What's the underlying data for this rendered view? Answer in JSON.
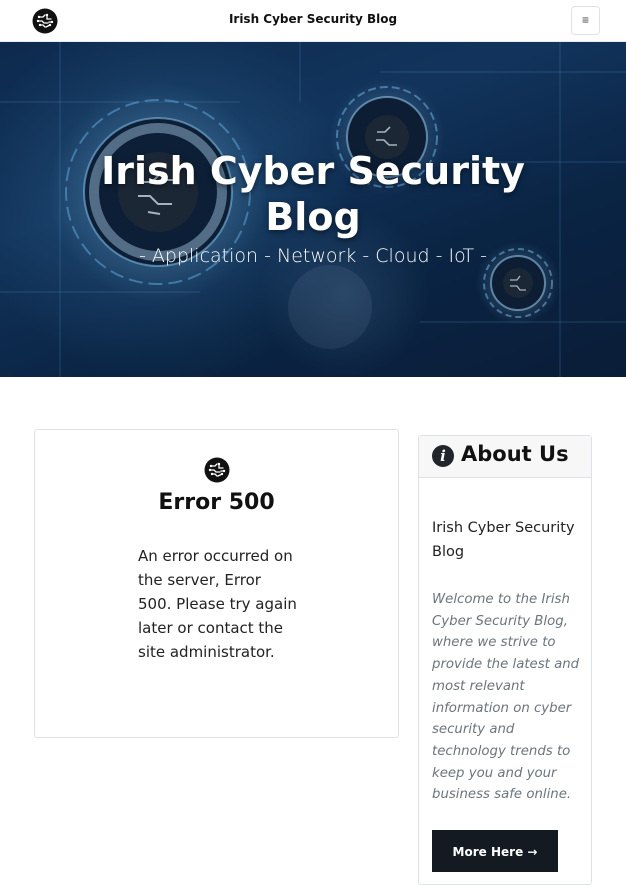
{
  "navbar": {
    "brand_title": "Irish Cyber Security Blog",
    "logo_icon": "circuit-logo-icon",
    "toggler_icon": "hamburger-menu-icon",
    "toggler_glyph": "≡"
  },
  "hero": {
    "title": "Irish Cyber Security Blog",
    "subtitle": "- Application - Network - Cloud - IoT -",
    "badge_text": "IRISH CYBER SECURITY BLOG"
  },
  "error": {
    "logo_icon": "circuit-logo-icon",
    "title": "Error 500",
    "message": "An error occurred on the server, Error 500. Please try again later or contact the site administrator."
  },
  "about": {
    "icon": "info-circle-icon",
    "icon_glyph": "i",
    "title": "About Us",
    "name": "Irish Cyber Security Blog",
    "description": "Welcome to the Irish Cyber Security Blog, where we strive to provide the latest and most relevant information on cyber security and technology trends to keep you and your business safe online.",
    "button_label": "More Here →"
  },
  "colors": {
    "hero_bg": "#0d2a4e",
    "button_bg": "#141a22",
    "muted_text": "#6c757d"
  }
}
